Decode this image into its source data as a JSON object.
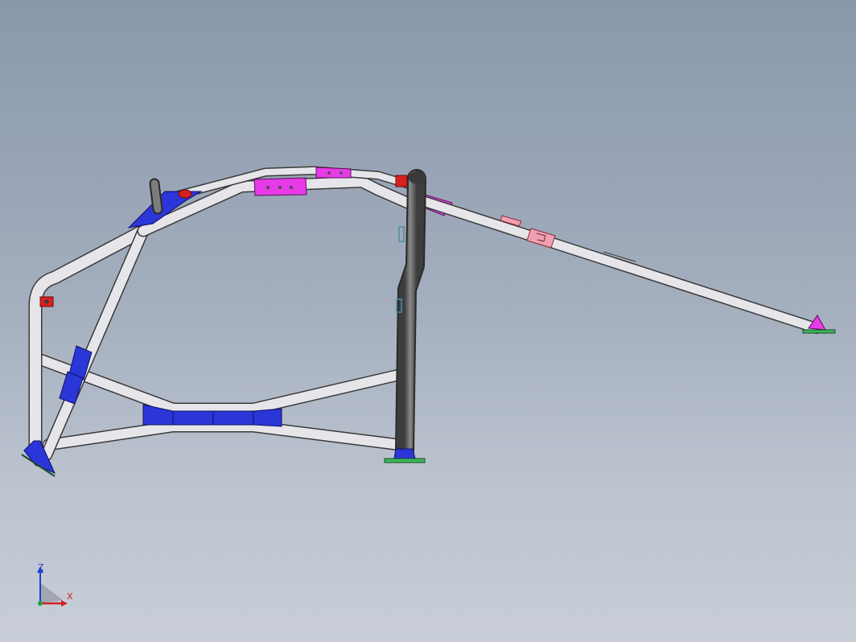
{
  "viewport": {
    "background_top": "#8a98ac",
    "background_bottom": "#c9ced8"
  },
  "colors": {
    "tube": "#e6e6ea",
    "tube_edge": "#3a3a3a",
    "tube_dark": "#6e6e6e",
    "gusset_blue": "#2a36d8",
    "clamp_magenta": "#e63be6",
    "clamp_pink": "#f0a0b0",
    "mount_red": "#d82020",
    "foot_green": "#3ab85a"
  },
  "triad": {
    "z_label": "Z",
    "x_label": "X",
    "z_color": "#1f3fd0",
    "x_color": "#cf2020"
  }
}
